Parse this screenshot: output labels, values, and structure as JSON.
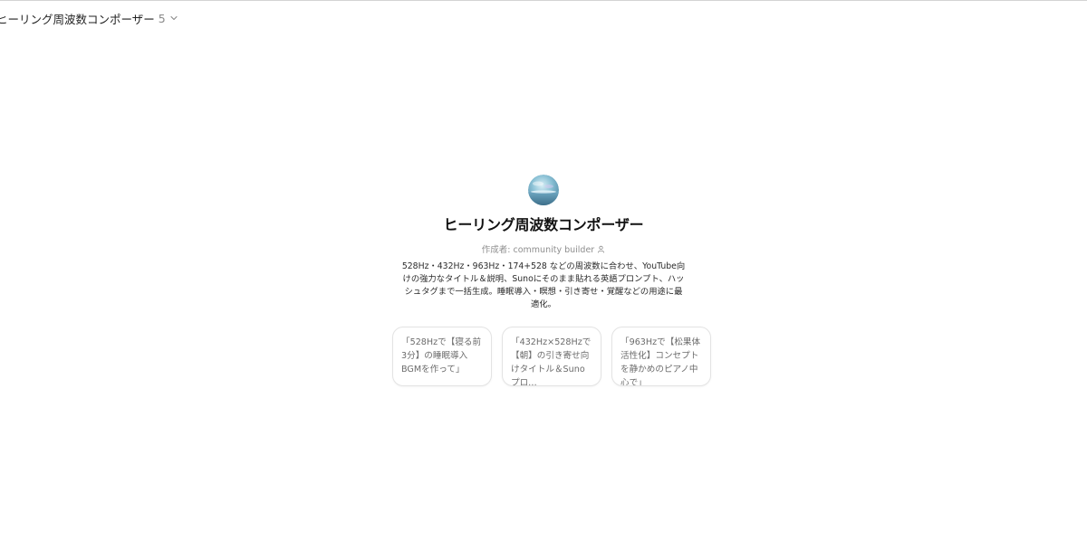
{
  "header": {
    "gpt_name": "ヒーリング周波数コンポーザー",
    "version": "5",
    "dropdown_icon": "chevron-down-icon"
  },
  "gpt": {
    "title": "ヒーリング周波数コンポーザー",
    "author": "作成者: community builder",
    "author_icon": "person-icon",
    "description": "528Hz・432Hz・963Hz・174+528 などの周波数に合わせ、YouTube向けの強力なタイトル＆説明、Sunoにそのまま貼れる英語プロンプト、ハッシュタグまで一括生成。睡眠導入・瞑想・引き寄せ・覚醒などの用途に最適化。"
  },
  "starters": [
    {
      "label": "「528Hzで【寝る前3分】の睡眠導入BGMを作って」"
    },
    {
      "label": "「432Hz×528Hzで【朝】の引き寄せ向けタイトル＆Sunoプロ…"
    },
    {
      "label": "「963Hzで【松果体活性化】コンセプトを静かめのピアノ中心で」"
    }
  ]
}
